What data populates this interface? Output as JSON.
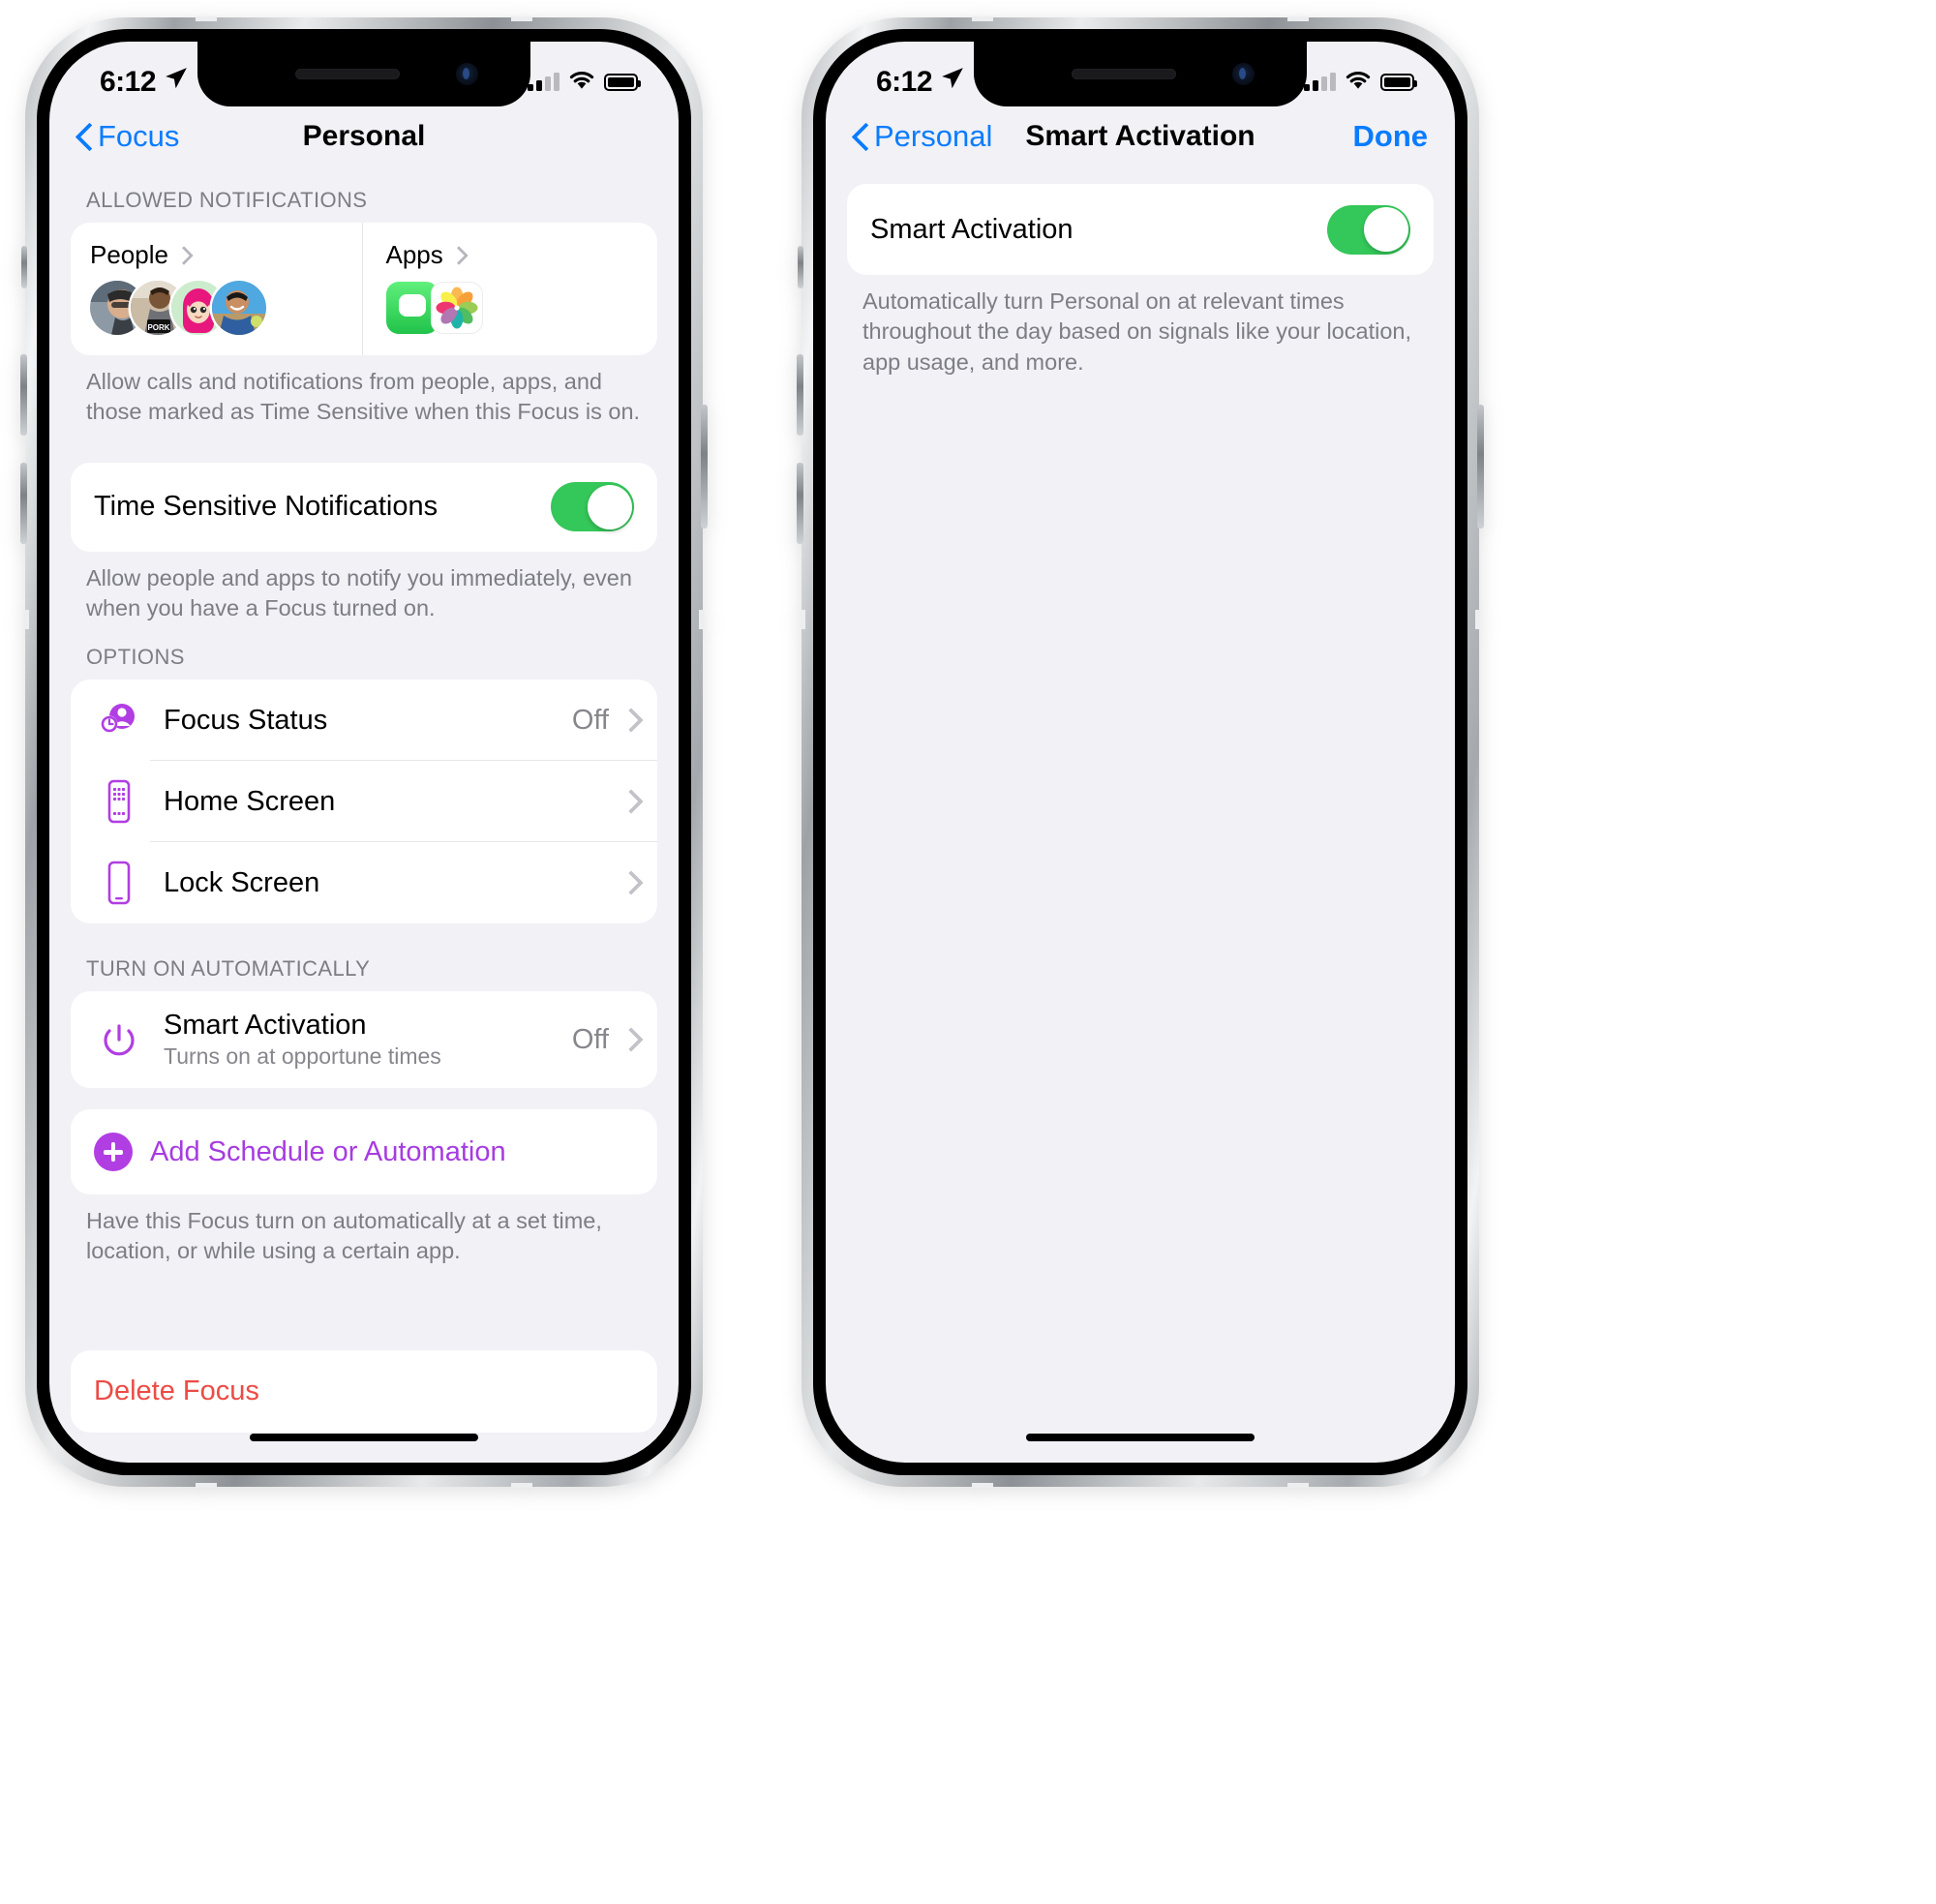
{
  "phones": [
    {
      "id": "personal-focus-settings",
      "status_bar": {
        "time": "6:12",
        "location_icon": "location-arrow-icon",
        "signal_icon": "cellular-bars-icon",
        "wifi_icon": "wifi-icon",
        "battery_icon": "battery-full-icon"
      },
      "nav": {
        "back_label": "Focus",
        "title": "Personal",
        "back_icon": "chevron-left-icon"
      },
      "sections": {
        "allowed_notifications": {
          "header": "ALLOWED NOTIFICATIONS",
          "people": {
            "label": "People",
            "chevron_icon": "chevron-right-icon",
            "avatar_count": 4
          },
          "apps": {
            "label": "Apps",
            "chevron_icon": "chevron-right-icon",
            "icons": [
              "messages-app-icon",
              "photos-app-icon"
            ]
          },
          "footnote": "Allow calls and notifications from people, apps, and those marked as Time Sensitive when this Focus is on."
        },
        "time_sensitive": {
          "title": "Time Sensitive Notifications",
          "toggle_state": "on",
          "footnote": "Allow people and apps to notify you immediately, even when you have a Focus turned on."
        },
        "options": {
          "header": "OPTIONS",
          "rows": [
            {
              "icon": "focus-status-icon",
              "title": "Focus Status",
              "value": "Off",
              "chevron_icon": "chevron-right-icon"
            },
            {
              "icon": "home-screen-icon",
              "title": "Home Screen",
              "value": "",
              "chevron_icon": "chevron-right-icon"
            },
            {
              "icon": "lock-screen-icon",
              "title": "Lock Screen",
              "value": "",
              "chevron_icon": "chevron-right-icon"
            }
          ]
        },
        "turn_on_automatically": {
          "header": "TURN ON AUTOMATICALLY",
          "smart_activation": {
            "icon": "power-icon",
            "title": "Smart Activation",
            "subtitle": "Turns on at opportune times",
            "value": "Off",
            "chevron_icon": "chevron-right-icon"
          },
          "add_schedule": {
            "icon": "plus-circle-icon",
            "label": "Add Schedule or Automation"
          },
          "footnote": "Have this Focus turn on automatically at a set time, location, or while using a certain app."
        },
        "delete": {
          "label": "Delete Focus"
        }
      }
    },
    {
      "id": "smart-activation-settings",
      "status_bar": {
        "time": "6:12",
        "location_icon": "location-arrow-icon",
        "signal_icon": "cellular-bars-icon",
        "wifi_icon": "wifi-icon",
        "battery_icon": "battery-full-icon"
      },
      "nav": {
        "back_label": "Personal",
        "title": "Smart Activation",
        "done_label": "Done",
        "back_icon": "chevron-left-icon"
      },
      "smart_activation": {
        "title": "Smart Activation",
        "toggle_state": "on",
        "footnote": "Automatically turn Personal on at relevant times throughout the day based on signals like your location, app usage, and more."
      }
    }
  ],
  "colors": {
    "accent_blue": "#0a7cff",
    "toggle_green": "#34c759",
    "purple_icon": "#b13ee3",
    "destructive_red": "#ec4b45",
    "group_bg": "#f1f1f6",
    "card_bg": "#ffffff",
    "secondary_text": "#7d7d84"
  }
}
